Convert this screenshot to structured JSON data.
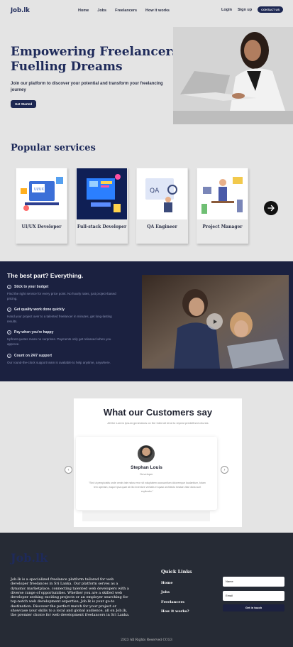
{
  "nav": {
    "logo": "Job.lk",
    "links": [
      "Home",
      "Jobs",
      "Freelancers",
      "How it works"
    ],
    "login": "Login",
    "signup": "Sign up",
    "contact": "CONTACT US"
  },
  "hero": {
    "title": "Empowering Freelancers, Fuelling Dreams",
    "subtitle": "Join our platform to discover your potential and transform your freelancing journey",
    "cta": "Get Started"
  },
  "services": {
    "title": "Popular services",
    "cards": [
      {
        "label": "UI/UX Developer",
        "icon": "ui-ux-illustration"
      },
      {
        "label": "Full-stack Developer",
        "icon": "fullstack-illustration"
      },
      {
        "label": "QA Engineer",
        "icon": "qa-illustration"
      },
      {
        "label": "Project Manager",
        "icon": "project-manager-illustration"
      }
    ]
  },
  "best": {
    "title": "The best part? Everything.",
    "features": [
      {
        "heading": "Stick to your budget",
        "text": "Find the right service for every price point. No hourly rates, just project-based pricing."
      },
      {
        "heading": "Get quality work done quickly",
        "text": "Hand your project over to a talented freelancer in minutes, get long-lasting results."
      },
      {
        "heading": "Pay when you're happy",
        "text": "Upfront quotes mean no surprises. Payments only get released when you approve."
      },
      {
        "heading": "Count on 24/7 support",
        "text": "Our round-the-clock support team is available to help anytime, anywhere."
      }
    ]
  },
  "testimonials": {
    "title": "What our Customers say",
    "subtitle": "All the Lorem Ipsum generators on the Internet tend to repeat predefined chunks",
    "name": "Stephan Louis",
    "role": "Developer",
    "quote": "\"Sed ut perspiciatis unde omnis iste natus error sit voluptatem accusantium doloremque laudantium, totam rem aperiam, eaque ipsa quae ab illo inventore veritatis et quasi architecto beatae vitae dicta sunt explicabo.\""
  },
  "footer": {
    "logo": "Job.lk",
    "about": "Job.lk is a specialized freelance platform tailored for web developer freelances in Sri Lanka. Our platform serves as a dynamic marketplace, connecting talented web developers with a diverse range of opportunities. Whether you are a skilled web developer seeking exciting projects or an employer searching for top-notch web development expertise, Job.lk is your go-to destination. Discover the perfect match for your project or showcase your skills to a local and global audience, all on Job.lk, the premier choice for web development freelancers in Sri Lanka.",
    "quick_links_title": "Quick Links",
    "quick_links": [
      "Home",
      "Jobs",
      "Freelancers",
      "How it works?"
    ],
    "name_placeholder": "Name",
    "email_placeholder": "Email",
    "submit": "Get in touch",
    "copyright": "2023 All Rights Reserved CCG3"
  },
  "colors": {
    "brand": "#1c2752",
    "dark_section": "#1b2140",
    "footer": "#262b35"
  }
}
